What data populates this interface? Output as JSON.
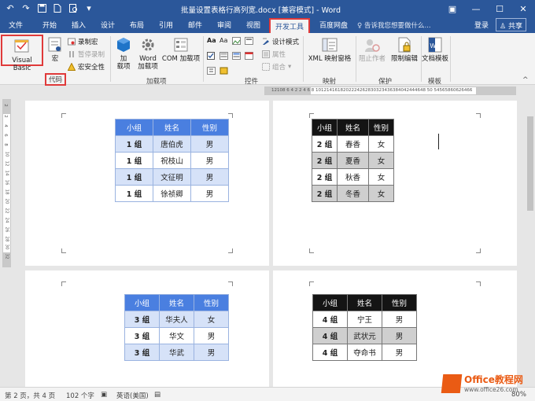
{
  "title_bar": {
    "doc_title": "批量设置表格行高列宽.docx [兼容模式] - Word",
    "quick_access": [
      "save-icon",
      "undo-icon",
      "redo-icon",
      "new-doc-icon",
      "print-preview-icon",
      "qat-menu-icon"
    ]
  },
  "tabs": [
    "文件",
    "开始",
    "插入",
    "设计",
    "布局",
    "引用",
    "邮件",
    "审阅",
    "视图",
    "开发工具",
    "百度网盘"
  ],
  "active_tab": "开发工具",
  "tell_me": "告诉我您想要做什么...",
  "sign_in": "登录",
  "share": "共享",
  "ribbon": {
    "code": {
      "label": "代码",
      "visual_basic": "Visual Basic",
      "macros": "宏",
      "record_macro": "录制宏",
      "pause_recording": "暂停录制",
      "macro_security": "宏安全性"
    },
    "addins": {
      "label": "加载项",
      "addins_btn": "加\n载项",
      "word_addins": "Word\n加载项",
      "com_addins": "COM 加载项"
    },
    "controls": {
      "label": "控件",
      "design_mode": "设计模式",
      "properties": "属性",
      "group": "组合"
    },
    "mapping": {
      "label": "映射",
      "xml_pane": "XML 映射窗格"
    },
    "protect": {
      "label": "保护",
      "block_authors": "阻止作者",
      "restrict_editing": "限制编辑"
    },
    "templates": {
      "label": "模板",
      "document_template": "文档模板"
    }
  },
  "rulers": {
    "horizontal": "12108 6 4 2  2 4 6 8 1012141618202224262830323436384042444648 50  54565860626466",
    "vertical": [
      "2",
      "2",
      "4",
      "6",
      "8",
      "10",
      "12",
      "14",
      "16",
      "18",
      "20",
      "22",
      "24",
      "26",
      "28",
      "30",
      "32",
      "32"
    ]
  },
  "tables": [
    {
      "headers": [
        "小组",
        "姓名",
        "性别"
      ],
      "rows": [
        [
          "1 组",
          "唐伯虎",
          "男"
        ],
        [
          "1 组",
          "祝枝山",
          "男"
        ],
        [
          "1 组",
          "文征明",
          "男"
        ],
        [
          "1 组",
          "徐祯卿",
          "男"
        ]
      ]
    },
    {
      "headers": [
        "小组",
        "姓名",
        "性别"
      ],
      "rows": [
        [
          "2 组",
          "春香",
          "女"
        ],
        [
          "2 组",
          "夏香",
          "女"
        ],
        [
          "2 组",
          "秋香",
          "女"
        ],
        [
          "2 组",
          "冬香",
          "女"
        ]
      ]
    },
    {
      "headers": [
        "小组",
        "姓名",
        "性别"
      ],
      "rows": [
        [
          "3 组",
          "华夫人",
          "女"
        ],
        [
          "3 组",
          "华文",
          "男"
        ],
        [
          "3 组",
          "华武",
          "男"
        ]
      ]
    },
    {
      "headers": [
        "小组",
        "姓名",
        "性别"
      ],
      "rows": [
        [
          "4 组",
          "宁王",
          "男"
        ],
        [
          "4 组",
          "武状元",
          "男"
        ],
        [
          "4 组",
          "夺命书",
          "男"
        ]
      ]
    }
  ],
  "status_bar": {
    "page": "第 2 页，共 4 页",
    "words": "102 个字",
    "language": "英语(美国)",
    "zoom": "80%"
  },
  "watermark": {
    "brand": "Office教程网",
    "url": "www.office26.com"
  },
  "colors": {
    "title_bar": "#2b579a",
    "highlight_red": "#e03a3a",
    "table_header_blue": "#4a7fe0",
    "table_row_blue": "#d6e2f8",
    "table_header_black": "#141414",
    "table_row_gray": "#cfcfcf"
  }
}
